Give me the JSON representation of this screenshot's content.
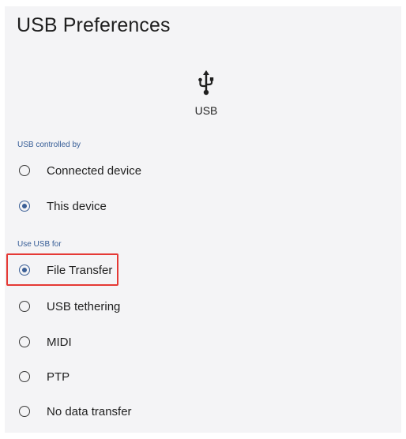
{
  "page": {
    "title": "USB Preferences"
  },
  "hero": {
    "icon": "usb-icon",
    "label": "USB"
  },
  "sections": {
    "controlled_by": {
      "header": "USB controlled by",
      "options": [
        {
          "label": "Connected device",
          "selected": false
        },
        {
          "label": "This device",
          "selected": true
        }
      ]
    },
    "use_for": {
      "header": "Use USB for",
      "options": [
        {
          "label": "File Transfer",
          "selected": true
        },
        {
          "label": "USB tethering",
          "selected": false
        },
        {
          "label": "MIDI",
          "selected": false
        },
        {
          "label": "PTP",
          "selected": false
        },
        {
          "label": "No data transfer",
          "selected": false
        }
      ]
    }
  },
  "colors": {
    "accent": "#3b5f96",
    "highlight": "#e53935",
    "background": "#f4f4f6"
  }
}
